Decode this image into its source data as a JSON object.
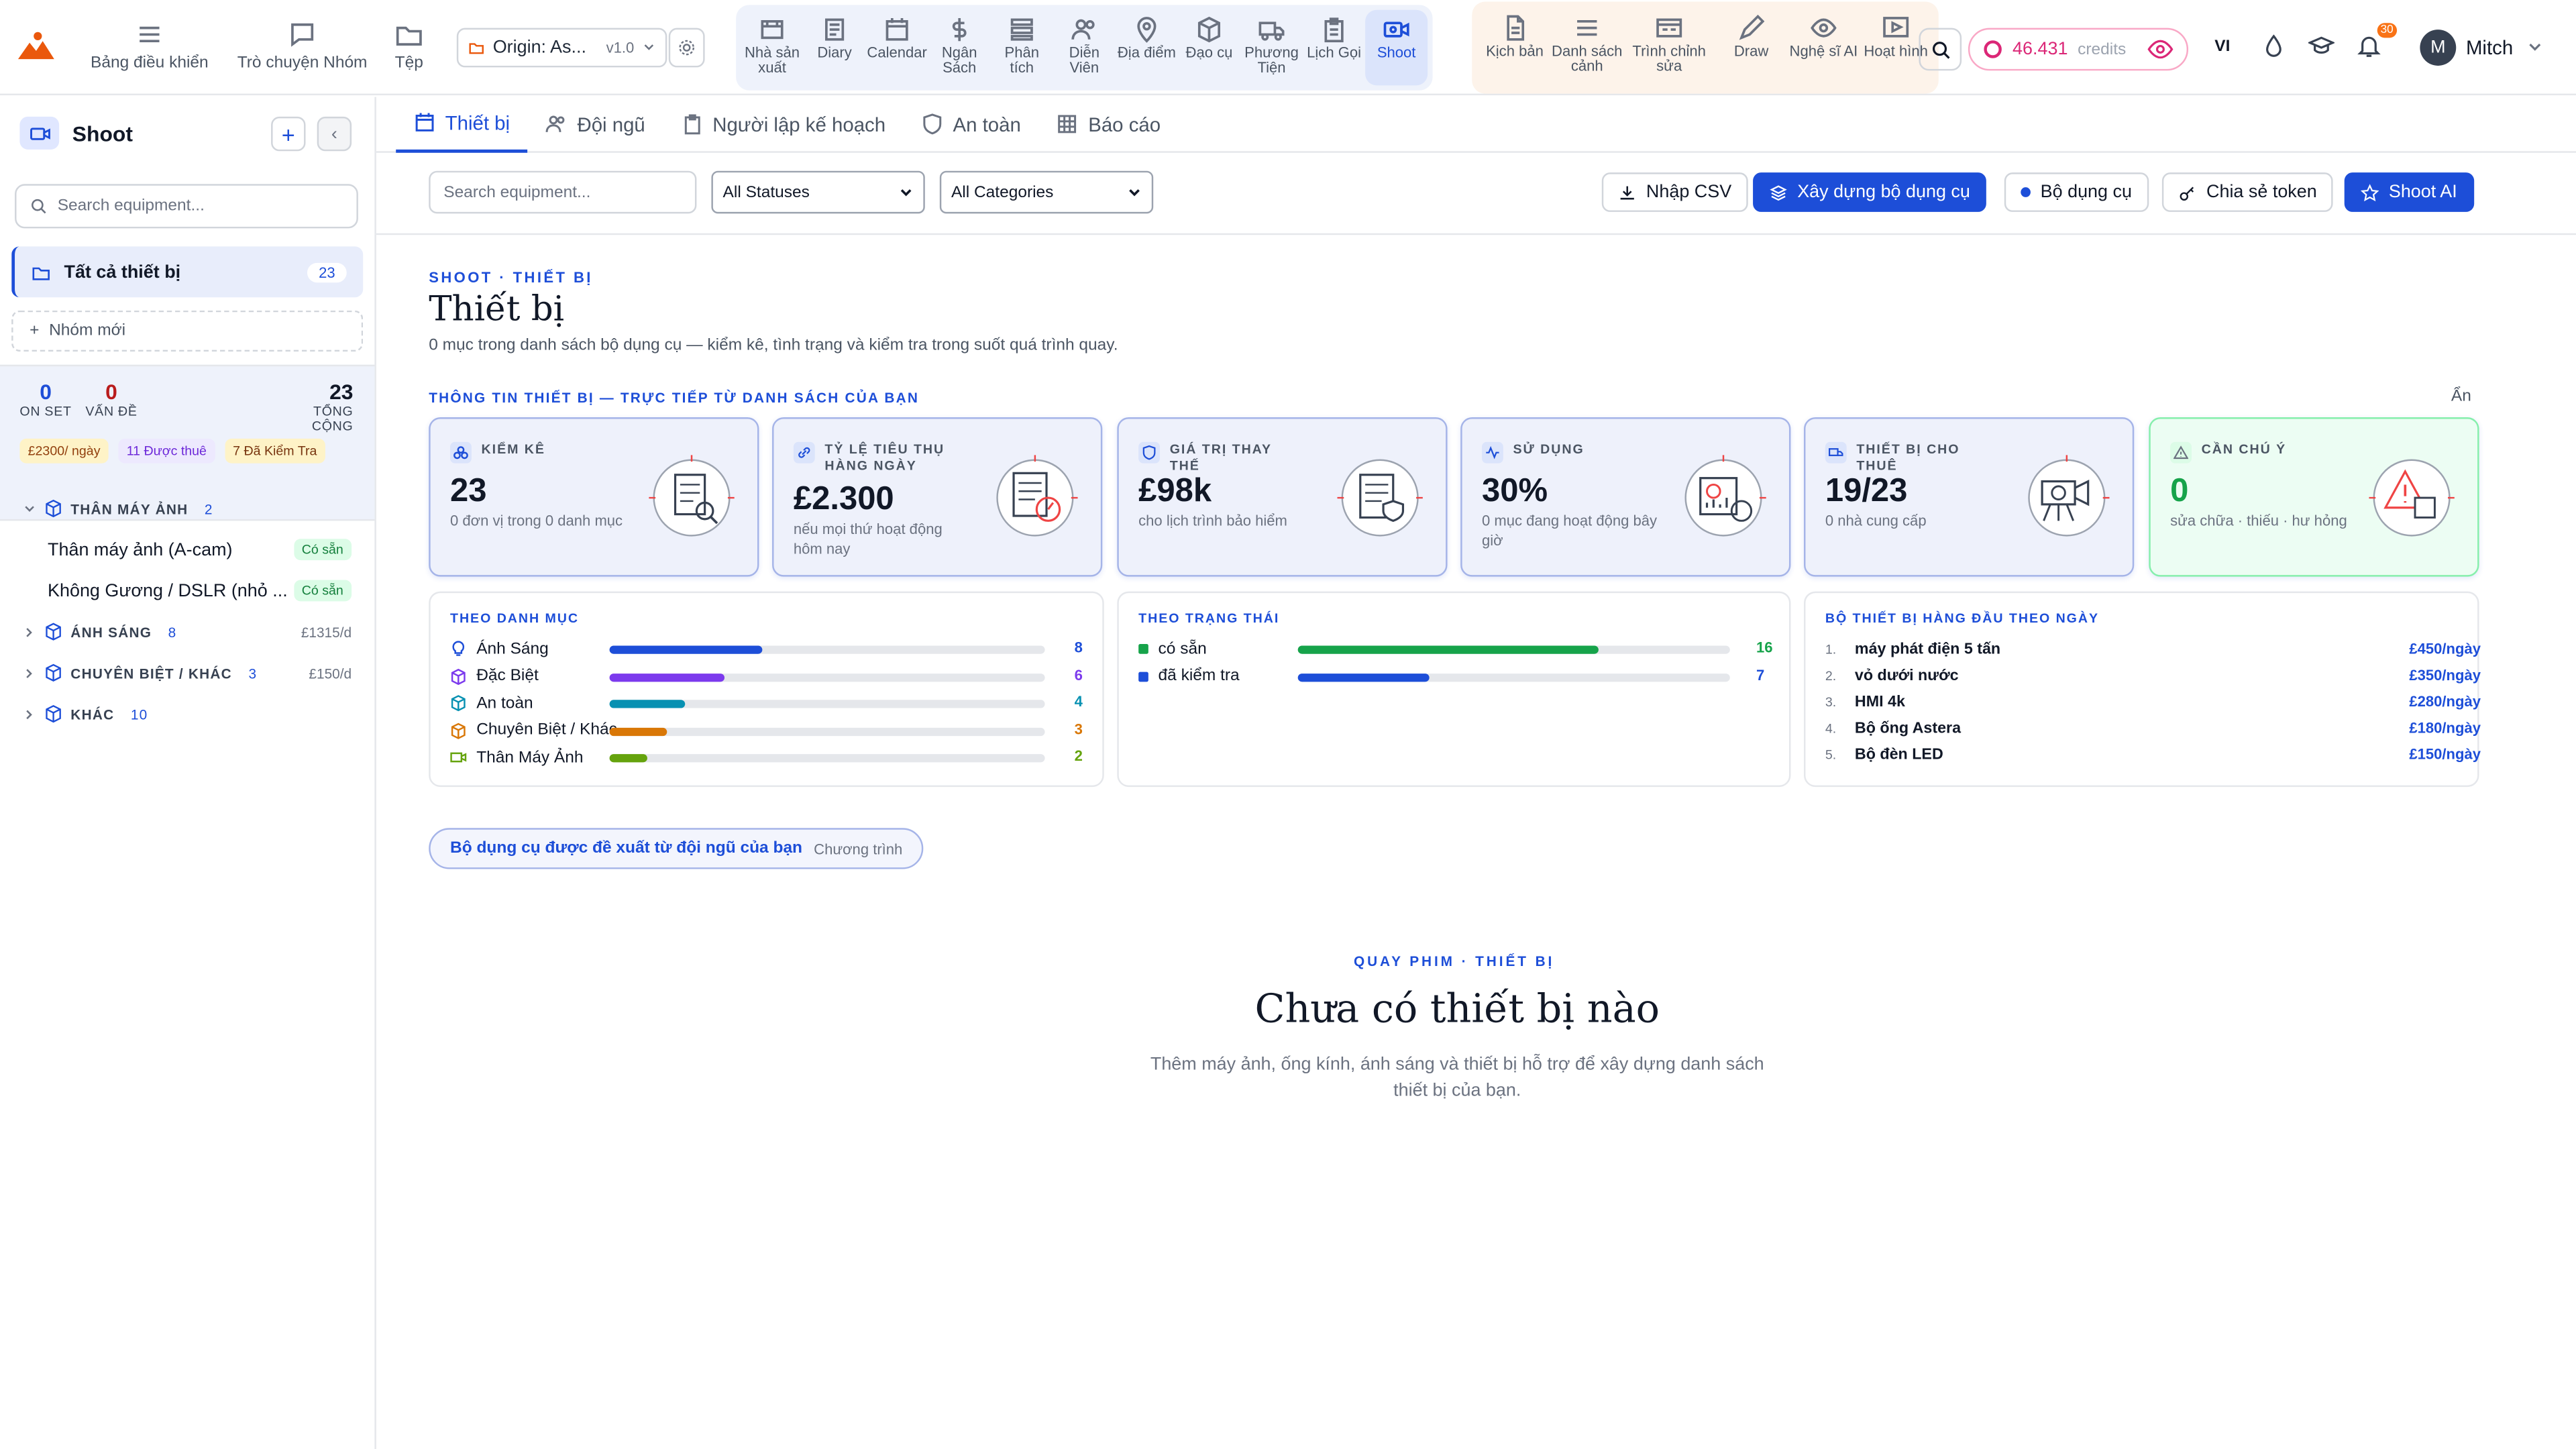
{
  "topnav": {
    "left_items": [
      {
        "label": "Bảng điều khiển",
        "icon": "menu-icon"
      },
      {
        "label": "Trò chuyện Nhóm",
        "icon": "chat-icon"
      },
      {
        "label": "Tệp",
        "icon": "folder-icon"
      }
    ],
    "origin": {
      "label": "Origin: As...",
      "version": "v1.0"
    },
    "modules": [
      {
        "label": "Nhà sản xuất",
        "icon": "film-icon"
      },
      {
        "label": "Diary",
        "icon": "diary-icon"
      },
      {
        "label": "Calendar",
        "icon": "calendar-icon"
      },
      {
        "label": "Ngân Sách",
        "icon": "dollar-icon"
      },
      {
        "label": "Phân tích",
        "icon": "stack-icon"
      },
      {
        "label": "Diễn Viên",
        "icon": "people-icon"
      },
      {
        "label": "Địa điểm",
        "icon": "pin-icon"
      },
      {
        "label": "Đạo cụ",
        "icon": "box-icon"
      },
      {
        "label": "Phương Tiện",
        "icon": "truck-icon"
      },
      {
        "label": "Lịch Gọi",
        "icon": "clipboard-icon"
      },
      {
        "label": "Shoot",
        "icon": "camera-icon",
        "active": true
      }
    ],
    "modules2": [
      {
        "label": "Kịch bản",
        "icon": "script-icon"
      },
      {
        "label": "Danh sách cảnh",
        "icon": "list-icon"
      },
      {
        "label": "Trình chỉnh sửa",
        "icon": "editor-icon"
      },
      {
        "label": "Draw",
        "icon": "pen-icon"
      },
      {
        "label": "Nghệ sĩ AI",
        "icon": "eye-icon"
      },
      {
        "label": "Hoạt hình",
        "icon": "play-icon"
      }
    ],
    "credits_value": "46.431",
    "credits_label": "credits",
    "language": "VI",
    "notifications": "30",
    "user_initial": "M",
    "user_name": "Mitch"
  },
  "sidebar": {
    "title": "Shoot",
    "search_placeholder": "Search equipment...",
    "all_label": "Tất cả thiết bị",
    "all_count": "23",
    "new_group": "Nhóm mới",
    "stats": [
      {
        "num": "0",
        "label": "ON SET",
        "color": "#1d4ed8"
      },
      {
        "num": "0",
        "label": "VẤN ĐỀ",
        "color": "#b91c1c"
      },
      {
        "num": "23",
        "label": "TỔNG CỘNG",
        "color": "#111827"
      }
    ],
    "badges": [
      {
        "text": "£2300/ ngày",
        "bg": "#fef3c7",
        "fg": "#92400e"
      },
      {
        "text": "11 Được thuê",
        "bg": "#ede9fe",
        "fg": "#6d28d9"
      },
      {
        "text": "7 Đã Kiểm Tra",
        "bg": "#fef3c7",
        "fg": "#78350f"
      }
    ],
    "categories": [
      {
        "name": "THÂN MÁY ẢNH",
        "count": "2",
        "rate": "",
        "expanded": true,
        "items": [
          {
            "name": "Thân máy ảnh (A-cam)",
            "status": "Có sẵn"
          },
          {
            "name": "Không Gương / DSLR (nhỏ ...",
            "status": "Có sẵn"
          }
        ]
      },
      {
        "name": "ÁNH SÁNG",
        "count": "8",
        "rate": "£1315/d",
        "expanded": false,
        "items": []
      },
      {
        "name": "CHUYÊN BIỆT / KHÁC",
        "count": "3",
        "rate": "£150/d",
        "expanded": false,
        "items": []
      },
      {
        "name": "KHÁC",
        "count": "10",
        "rate": "",
        "expanded": false,
        "items": []
      }
    ]
  },
  "tabs": [
    {
      "label": "Thiết bị",
      "icon": "calendar-icon",
      "active": true
    },
    {
      "label": "Đội ngũ",
      "icon": "people-icon"
    },
    {
      "label": "Người lập kế hoạch",
      "icon": "clipboard-icon"
    },
    {
      "label": "An toàn",
      "icon": "shield-icon"
    },
    {
      "label": "Báo cáo",
      "icon": "grid-icon"
    }
  ],
  "toolbar": {
    "search_placeholder": "Search equipment...",
    "status_filter": "All Statuses",
    "category_filter": "All Categories",
    "import_csv": "Nhập CSV",
    "build_kit": "Xây dựng bộ dụng cụ",
    "kit": "Bộ dụng cụ",
    "share_token": "Chia sẻ token",
    "shoot_ai": "Shoot AI"
  },
  "main": {
    "kicker": "SHOOT · THIẾT BỊ",
    "title": "Thiết bị",
    "subtitle": "0 mục trong danh sách bộ dụng cụ — kiểm kê, tình trạng và kiểm tra trong suốt quá trình quay.",
    "insights_kicker": "THÔNG TIN THIẾT BỊ — TRỰC TIẾP TỪ DANH SÁCH CỦA BẠN",
    "hide_label": "Ẩn"
  },
  "cards": [
    {
      "title": "KIỂM KÊ",
      "value": "23",
      "sub": "0 đơn vị trong 0 danh mục",
      "value_color": "#111827"
    },
    {
      "title": "TỶ LỆ TIÊU THỤ HÀNG NGÀY",
      "value": "£2.300",
      "sub": "nếu mọi thứ hoạt động hôm nay",
      "value_color": "#111827"
    },
    {
      "title": "GIÁ TRỊ THAY THẾ",
      "value": "£98k",
      "sub": "cho lịch trình bảo hiểm",
      "value_color": "#111827"
    },
    {
      "title": "SỬ DỤNG",
      "value": "30%",
      "sub": "0 mục đang hoạt động bây giờ",
      "value_color": "#111827"
    },
    {
      "title": "THIẾT BỊ CHO THUÊ",
      "value": "19/23",
      "sub": "0 nhà cung cấp",
      "value_color": "#111827"
    },
    {
      "title": "CẦN CHÚ Ý",
      "value": "0",
      "sub": "sửa chữa · thiếu · hư hỏng",
      "value_color": "#16a34a"
    }
  ],
  "by_category": {
    "title": "THEO DANH MỤC",
    "max": 8,
    "rows": [
      {
        "name": "Ánh Sáng",
        "value": 8,
        "color": "#1d4ed8",
        "icon": "bulb-icon"
      },
      {
        "name": "Đặc Biệt",
        "value": 6,
        "color": "#7c3aed",
        "icon": "cube-icon"
      },
      {
        "name": "An toàn",
        "value": 4,
        "color": "#0891b2",
        "icon": "shield-cube-icon"
      },
      {
        "name": "Chuyên Biệt / Khác",
        "value": 3,
        "color": "#d97706",
        "icon": "box-icon"
      },
      {
        "name": "Thân Máy Ảnh",
        "value": 2,
        "color": "#65a30d",
        "icon": "camera-icon"
      }
    ]
  },
  "by_status": {
    "title": "THEO TRẠNG THÁI",
    "max": 23,
    "rows": [
      {
        "name": "có sẵn",
        "value": 16,
        "color": "#16a34a"
      },
      {
        "name": "đã kiểm tra",
        "value": 7,
        "color": "#1d4ed8"
      }
    ]
  },
  "top_kits": {
    "title": "BỘ THIẾT BỊ HÀNG ĐẦU THEO NGÀY",
    "rows": [
      {
        "rank": "1.",
        "name": "máy phát điện 5 tấn",
        "price": "£450/ngày"
      },
      {
        "rank": "2.",
        "name": "vỏ dưới nước",
        "price": "£350/ngày"
      },
      {
        "rank": "3.",
        "name": "HMI 4k",
        "price": "£280/ngày"
      },
      {
        "rank": "4.",
        "name": "Bộ ống Astera",
        "price": "£180/ngày"
      },
      {
        "rank": "5.",
        "name": "Bộ đèn LED",
        "price": "£150/ngày"
      }
    ]
  },
  "suggest": {
    "label": "Bộ dụng cụ được đề xuất từ đội ngũ của bạn",
    "sub": "Chương trình"
  },
  "empty": {
    "kicker": "QUAY PHIM · THIẾT BỊ",
    "title": "Chưa có thiết bị nào",
    "sub": "Thêm máy ảnh, ống kính, ánh sáng và thiết bị hỗ trợ để xây dựng danh sách thiết bị của bạn."
  }
}
